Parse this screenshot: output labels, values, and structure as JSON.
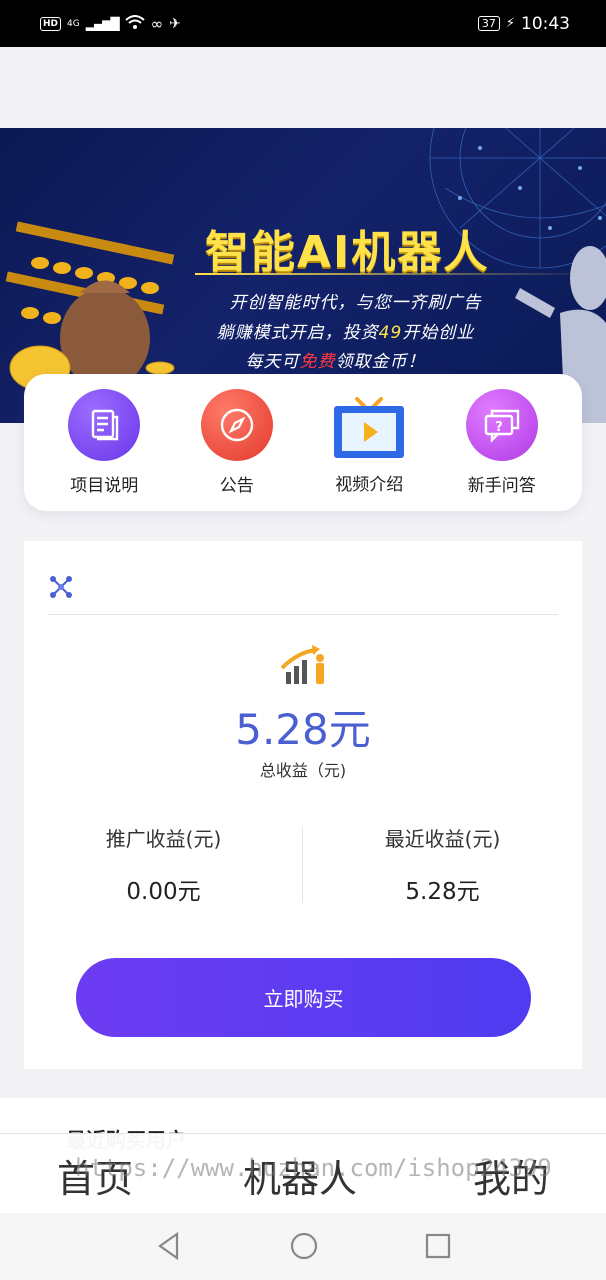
{
  "status_bar": {
    "hd": "HD",
    "network": "4G",
    "battery": "37",
    "time": "10:43"
  },
  "banner": {
    "title": "智能AI机器人",
    "line1": "开创智能时代，与您一齐刷广告",
    "line2_a": "躺赚模式开启，投资",
    "line2_b": "49",
    "line2_c": "开始创业",
    "line3_a": "每天可",
    "line3_b": "免费",
    "line3_c": "领取金币！"
  },
  "quick_links": [
    {
      "label": "项目说明",
      "icon": "document-icon",
      "color": "#7a4cf0"
    },
    {
      "label": "公告",
      "icon": "compass-icon",
      "color": "#ef4c3c"
    },
    {
      "label": "视频介绍",
      "icon": "tv-play-icon",
      "color": "#2f6ae6"
    },
    {
      "label": "新手问答",
      "icon": "chat-question-icon",
      "color": "#c04ce8"
    }
  ],
  "earnings": {
    "total": "5.28元",
    "total_label": "总收益（元)",
    "promo_label": "推广收益(元)",
    "promo_value": "0.00元",
    "recent_label": "最近收益(元)",
    "recent_value": "5.28元",
    "buy_label": "立即购买"
  },
  "recent": {
    "title": "最近购买用户"
  },
  "bottom_nav": {
    "home": "首页",
    "robot": "机器人",
    "mine": "我的"
  },
  "watermark": "https://www.huzhan.com/ishop24399",
  "colors": {
    "accent": "#4a5fd0",
    "button": "#5a3cf1",
    "banner_bg": "#0c1852",
    "banner_title": "#ffe14a"
  }
}
